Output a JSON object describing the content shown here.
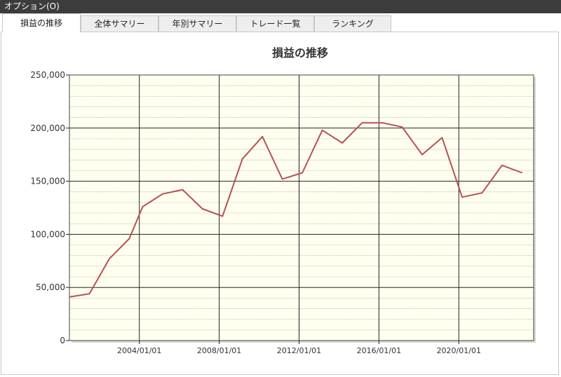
{
  "window": {
    "title": "オプション(O)"
  },
  "tabs": [
    {
      "label": "損益の推移",
      "active": true
    },
    {
      "label": "全体サマリー",
      "active": false
    },
    {
      "label": "年別サマリー",
      "active": false
    },
    {
      "label": "トレード一覧",
      "active": false
    },
    {
      "label": "ランキング",
      "active": false
    }
  ],
  "chart_data": {
    "type": "line",
    "title": "損益の推移",
    "xlabel": "",
    "ylabel": "",
    "grid": true,
    "legend": "none",
    "ylim": [
      0,
      250000
    ],
    "xlim": [
      "2000-07-01",
      "2023-10-01"
    ],
    "y_ticks": [
      "0",
      "50,000",
      "100,000",
      "150,000",
      "200,000",
      "250,000"
    ],
    "x_ticks": [
      "2004/01/01",
      "2008/01/01",
      "2012/01/01",
      "2016/01/01",
      "2020/01/01"
    ],
    "plot_background": "#fffff0",
    "series": [
      {
        "color": "#b85050",
        "points": [
          [
            "2000-07-01",
            41000
          ],
          [
            "2001-07-01",
            44000
          ],
          [
            "2002-07-01",
            77000
          ],
          [
            "2003-07-01",
            96000
          ],
          [
            "2004-03-01",
            126000
          ],
          [
            "2005-03-01",
            138000
          ],
          [
            "2006-03-01",
            142000
          ],
          [
            "2007-03-01",
            124000
          ],
          [
            "2008-03-01",
            117000
          ],
          [
            "2009-03-01",
            171000
          ],
          [
            "2010-03-01",
            192000
          ],
          [
            "2011-03-01",
            152000
          ],
          [
            "2012-03-01",
            158000
          ],
          [
            "2013-03-01",
            198000
          ],
          [
            "2014-03-01",
            186000
          ],
          [
            "2015-03-01",
            205000
          ],
          [
            "2016-03-01",
            205000
          ],
          [
            "2017-03-01",
            201000
          ],
          [
            "2018-03-01",
            175000
          ],
          [
            "2019-03-01",
            191000
          ],
          [
            "2020-03-01",
            135000
          ],
          [
            "2021-03-01",
            139000
          ],
          [
            "2022-03-01",
            165000
          ],
          [
            "2023-03-01",
            158000
          ]
        ]
      }
    ]
  }
}
